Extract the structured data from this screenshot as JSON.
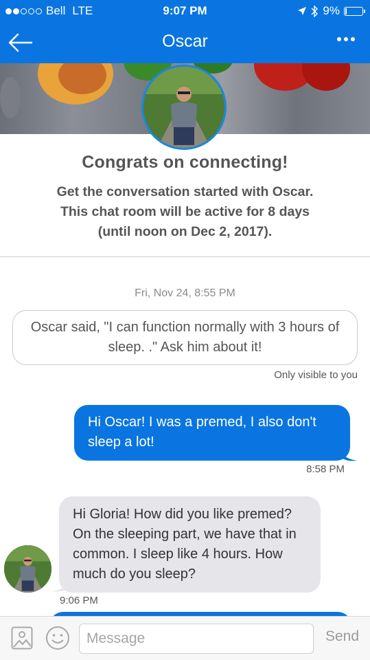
{
  "status_bar": {
    "carrier": "Bell",
    "network": "LTE",
    "time": "9:07 PM",
    "battery": "9%",
    "signal_bars": 2,
    "battery_level": 0.09
  },
  "nav": {
    "title": "Oscar"
  },
  "welcome": {
    "heading": "Congrats on connecting!",
    "line1": "Get the conversation started with Oscar.",
    "line2": "This chat room will be active for 8 days",
    "line3": "(until noon on Dec 2, 2017)."
  },
  "chat": {
    "timestamp": "Fri, Nov 24, 8:55 PM",
    "system_message": {
      "text": "Oscar said, \"I can function normally with 3 hours of sleep. .\" Ask him about it!",
      "note": "Only visible to you"
    },
    "outgoing": {
      "text": "Hi Oscar! I was a premed, I also don't sleep a lot!",
      "time": "8:58 PM"
    },
    "incoming": {
      "text": "Hi Gloria! How did you like premed? On the sleeping part, we have that in common. I sleep like 4 hours. How much do you sleep?",
      "time": "9:06 PM"
    }
  },
  "composer": {
    "placeholder": "Message",
    "send_label": "Send"
  },
  "colors": {
    "primary": "#0a75e0",
    "incoming_bubble": "#e5e5ea"
  },
  "icons": [
    "back-arrow-icon",
    "more-options-icon",
    "location-arrow-icon",
    "bluetooth-icon",
    "battery-icon",
    "image-icon",
    "emoji-icon"
  ]
}
